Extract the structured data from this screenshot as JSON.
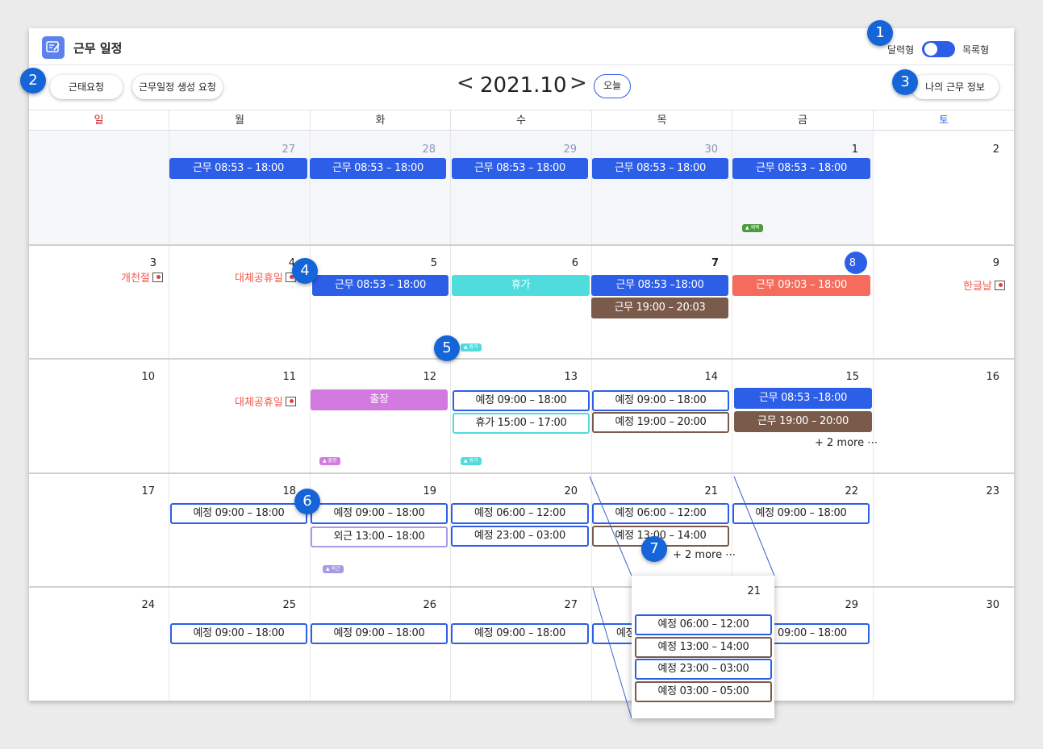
{
  "header": {
    "title": "근무 일정",
    "view_calendar": "달력형",
    "view_list": "목록형"
  },
  "toolbar": {
    "attendance_request": "근태요청",
    "schedule_request": "근무일정 생성 요청",
    "prev": "<",
    "month": "2021.10",
    "next": ">",
    "today": "오늘",
    "my_info": "나의 근무 정보"
  },
  "weekdays": [
    "일",
    "월",
    "화",
    "수",
    "목",
    "금",
    "토"
  ],
  "days": {
    "d27": "27",
    "d28": "28",
    "d29": "29",
    "d30": "30",
    "d1": "1",
    "d2": "2",
    "d3": "3",
    "d4": "4",
    "d5": "5",
    "d6": "6",
    "d7": "7",
    "d8": "8",
    "d9": "9",
    "d10": "10",
    "d11": "11",
    "d12": "12",
    "d13": "13",
    "d14": "14",
    "d15": "15",
    "d16": "16",
    "d17": "17",
    "d18": "18",
    "d19": "19",
    "d20": "20",
    "d21": "21",
    "d22": "22",
    "d23": "23",
    "d24": "24",
    "d25": "25",
    "d26": "26",
    "d27b": "27",
    "d29b": "29",
    "d30b": "30"
  },
  "holidays": {
    "h3": "개천절",
    "h4": "대체공휴일",
    "h9": "한글날",
    "h11": "대체공휴일"
  },
  "events": {
    "w1": "근무 08:53 – 18:00",
    "leave": "휴가",
    "w7a": "근무 08:53 –18:00",
    "w7b": "근무 19:00 – 20:03",
    "w8": "근무 09:03 – 18:00",
    "trip": "출장",
    "p13a": "예정 09:00 – 18:00",
    "p13b": "휴가 15:00 – 17:00",
    "p14a": "예정 09:00 – 18:00",
    "p14b": "예정 19:00 – 20:00",
    "w15a": "근무 08:53 –18:00",
    "w15b": "근무 19:00 – 20:00",
    "p18": "예정 09:00 – 18:00",
    "p19a": "예정 09:00 – 18:00",
    "p19b": "외근 13:00 – 18:00",
    "p20a": "예정 06:00 – 12:00",
    "p20b": "예정 23:00 – 03:00",
    "p21a": "예정 06:00 – 12:00",
    "p21b": "예정 13:00 – 14:00",
    "p22": "예정 09:00 – 18:00",
    "p25": "예정 09:00 – 18:00",
    "p26": "예정 09:00 – 18:00",
    "p27": "예정 09:00 – 18:00",
    "p28": "예정",
    "p29": "09:00 – 18:00"
  },
  "more": {
    "m15": "+ 2 more ⋯",
    "m21": "+ 2 more ⋯"
  },
  "tags": {
    "t1": "재택",
    "t6": "휴가",
    "t12": "출장",
    "t13": "휴가",
    "t19": "외근"
  },
  "popup": {
    "day": "21",
    "items": [
      "예정 06:00 – 12:00",
      "예정 13:00 – 14:00",
      "예정 23:00 – 03:00",
      "예정 03:00 – 05:00"
    ]
  },
  "callouts": [
    "1",
    "2",
    "3",
    "4",
    "5",
    "6",
    "7"
  ],
  "colors": {
    "work_blue": "#2d5ee8",
    "leave_teal": "#4fdcdc",
    "late_red": "#f56b5c",
    "overtime_brown": "#7a5a4b",
    "trip_purple": "#d27ae0",
    "holiday_text": "#f05a4a",
    "callout_blue": "#1565d8"
  }
}
